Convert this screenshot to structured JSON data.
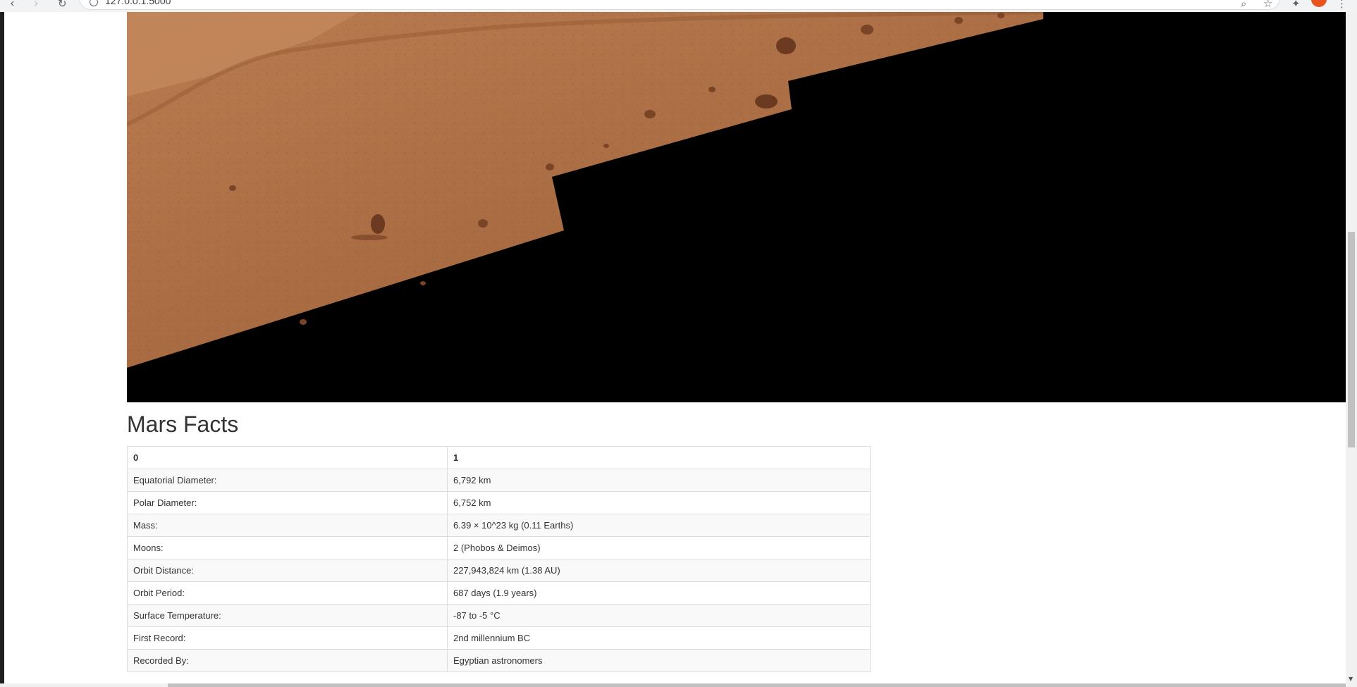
{
  "browser": {
    "url": "127.0.0.1:5000",
    "back_glyph": "‹",
    "forward_glyph": "›",
    "reload_glyph": "↻",
    "zoom_glyph": "⌕",
    "star_glyph": "☆",
    "extension_glyph": "✦",
    "menu_glyph": "⋮",
    "avatar_color": "#e8531f"
  },
  "hero_image": {
    "alt": "Mars surface panorama",
    "colors": {
      "terrain_light": "#c2855a",
      "terrain_mid": "#a8673f",
      "terrain_dark": "#7a4526",
      "rock": "#6b3a20",
      "void": "#000000"
    }
  },
  "facts": {
    "title": "Mars Facts",
    "headers": [
      "0",
      "1"
    ],
    "rows": [
      [
        "Equatorial Diameter:",
        "6,792 km"
      ],
      [
        "Polar Diameter:",
        "6,752 km"
      ],
      [
        "Mass:",
        "6.39 × 10^23 kg (0.11 Earths)"
      ],
      [
        "Moons:",
        "2 (Phobos & Deimos)"
      ],
      [
        "Orbit Distance:",
        "227,943,824 km (1.38 AU)"
      ],
      [
        "Orbit Period:",
        "687 days (1.9 years)"
      ],
      [
        "Surface Temperature:",
        "-87 to -5 °C"
      ],
      [
        "First Record:",
        "2nd millennium BC"
      ],
      [
        "Recorded By:",
        "Egyptian astronomers"
      ]
    ]
  },
  "scrollbars": {
    "down_arrow": "▼"
  }
}
